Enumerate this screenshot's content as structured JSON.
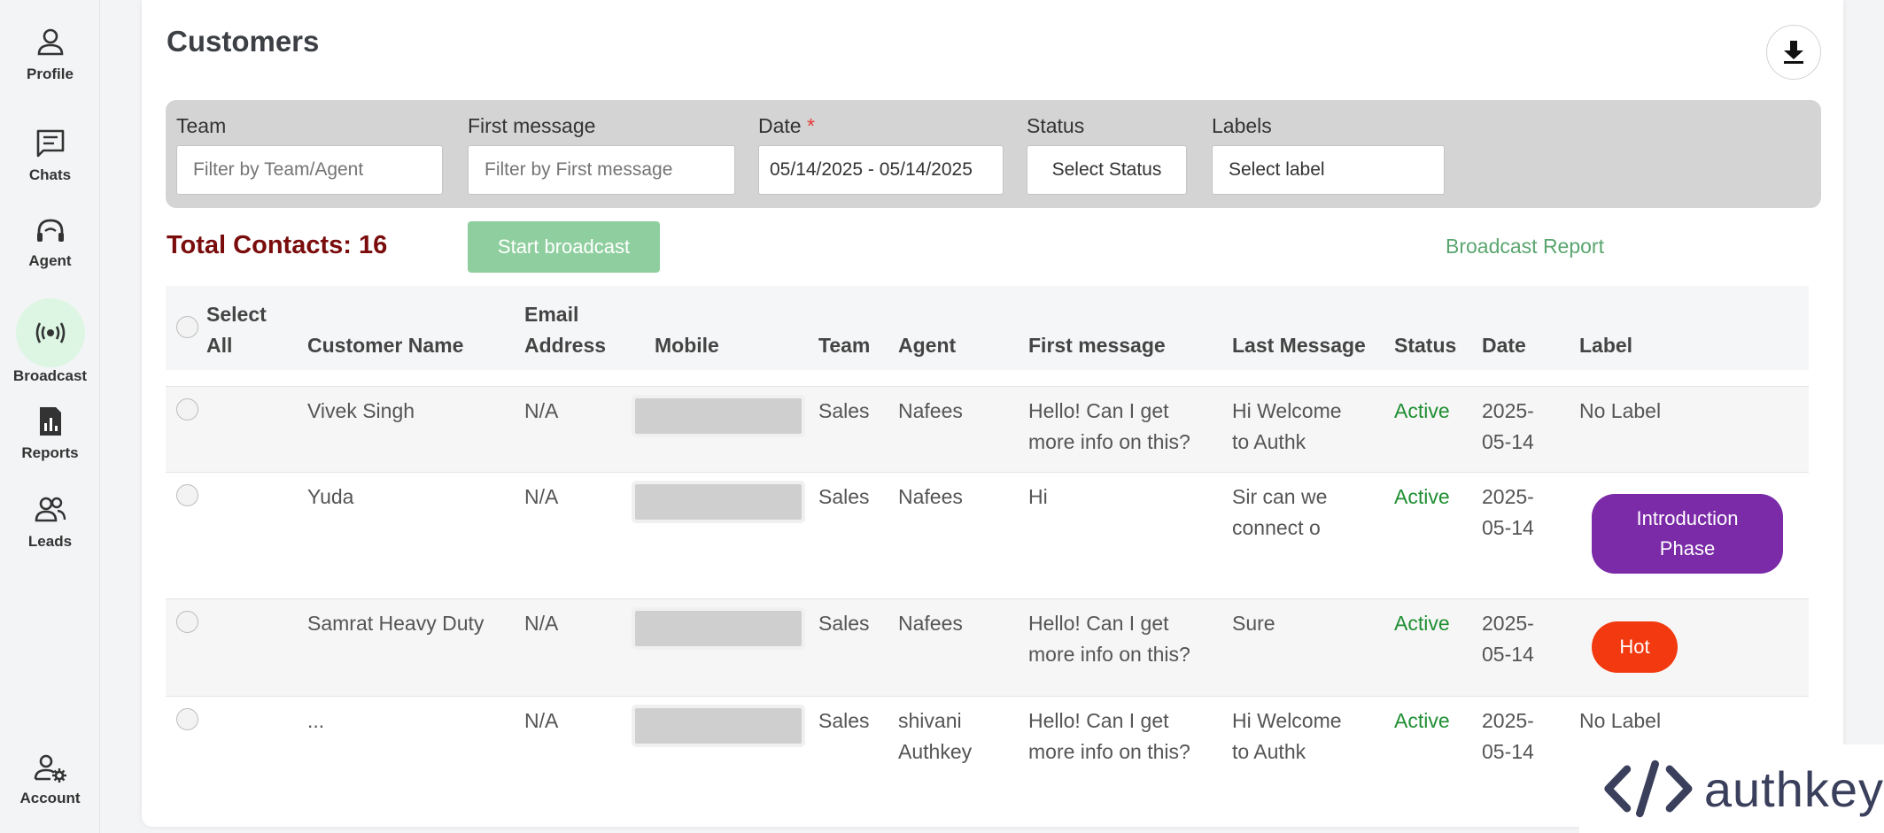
{
  "sidebar": {
    "items": [
      {
        "label": "Profile",
        "icon": "person-icon"
      },
      {
        "label": "Chats",
        "icon": "chat-icon"
      },
      {
        "label": "Agent",
        "icon": "headset-icon"
      },
      {
        "label": "Broadcast",
        "icon": "broadcast-icon",
        "active": true
      },
      {
        "label": "Reports",
        "icon": "report-icon"
      },
      {
        "label": "Leads",
        "icon": "people-icon"
      },
      {
        "label": "Account",
        "icon": "account-settings-icon"
      }
    ]
  },
  "header": {
    "title": "Customers",
    "download_icon": "download-icon"
  },
  "filters": {
    "team": {
      "label": "Team",
      "placeholder": "Filter by Team/Agent"
    },
    "first_message": {
      "label": "First message",
      "placeholder": "Filter by First message"
    },
    "date": {
      "label": "Date",
      "required_mark": "*",
      "value": "05/14/2025 - 05/14/2025"
    },
    "status": {
      "label": "Status",
      "value": "Select Status"
    },
    "labels": {
      "label": "Labels",
      "value": "Select label"
    }
  },
  "summary": {
    "total_contacts": "Total Contacts: 16",
    "start_broadcast": "Start broadcast",
    "broadcast_report": "Broadcast Report"
  },
  "table": {
    "headers": {
      "select_all_1": "Select",
      "select_all_2": "All",
      "customer_name": "Customer Name",
      "email_1": "Email",
      "email_2": "Address",
      "mobile": "Mobile",
      "team": "Team",
      "agent": "Agent",
      "first_message": "First message",
      "last_message": "Last Message",
      "status": "Status",
      "date": "Date",
      "label": "Label"
    },
    "rows": [
      {
        "name": "Vivek Singh",
        "email": "N/A",
        "team": "Sales",
        "agent_1": "Nafees",
        "agent_2": "",
        "first_1": "Hello! Can I get",
        "first_2": "more info on this?",
        "last_1": "Hi Welcome",
        "last_2": "to Authk",
        "status": "Active",
        "date_1": "2025-",
        "date_2": "05-14",
        "label": "No Label"
      },
      {
        "name": "Yuda",
        "email": "N/A",
        "team": "Sales",
        "agent_1": "Nafees",
        "agent_2": "",
        "first_1": "Hi",
        "first_2": "",
        "last_1": "Sir can we",
        "last_2": "connect o",
        "status": "Active",
        "date_1": "2025-",
        "date_2": "05-14",
        "label_1": "Introduction",
        "label_2": "Phase",
        "label_color": "#7b2aa8"
      },
      {
        "name": "Samrat Heavy Duty",
        "email": "N/A",
        "team": "Sales",
        "agent_1": "Nafees",
        "agent_2": "",
        "first_1": "Hello! Can I get",
        "first_2": "more info on this?",
        "last_1": "Sure",
        "last_2": "",
        "status": "Active",
        "date_1": "2025-",
        "date_2": "05-14",
        "label": "Hot",
        "label_color": "#f2390f"
      },
      {
        "name": "...",
        "email": "N/A",
        "team": "Sales",
        "agent_1": "shivani",
        "agent_2": "Authkey",
        "first_1": "Hello! Can I get",
        "first_2": "more info on this?",
        "last_1": "Hi Welcome",
        "last_2": "to Authk",
        "status": "Active",
        "date_1": "2025-",
        "date_2": "05-14",
        "label": "No Label"
      }
    ]
  },
  "logo": {
    "text": "authkey",
    "icon": "code-brackets-icon"
  },
  "colors": {
    "total_contacts": "#7a0c0c",
    "active_status": "#1f8f32",
    "broadcast_button": "#8fcf9f",
    "broadcast_active_bg": "#dcf6e3"
  }
}
